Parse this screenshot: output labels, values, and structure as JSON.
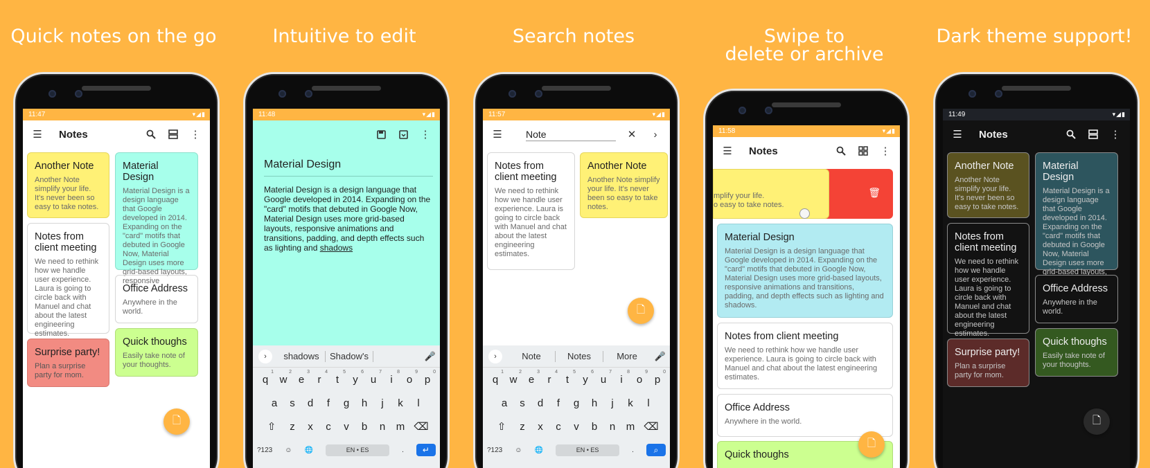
{
  "captions": [
    "Quick notes on the go",
    "Intuitive to edit",
    "Search notes",
    "Swipe to",
    "delete or archive",
    "Dark theme support!"
  ],
  "phones": {
    "p1": {
      "time": "11:47",
      "app_title": "Notes",
      "notes": [
        {
          "title": "Another Note",
          "body": "Another Note simplify your life. It's never been so easy to take notes."
        },
        {
          "title": "Notes from client meeting",
          "body": "We need to rethink how we handle user experience. Laura is going to circle back with Manuel and chat about the latest engineering estimates."
        },
        {
          "title": "Surprise party!",
          "body": "Plan a surprise party for mom."
        },
        {
          "title": "Material Design",
          "body": "Material Design is a design language that Google developed in 2014. Expanding on the \"card\" motifs that debuted in Google Now, Material Design uses more grid-based layouts, responsive"
        },
        {
          "title": "Office Address",
          "body": "Anywhere in the world."
        },
        {
          "title": "Quick thoughs",
          "body": "Easily take note of your thoughts."
        }
      ]
    },
    "p2": {
      "time": "11:48",
      "note_title": "Material Design",
      "note_body": "Material Design is a design language that Google developed in 2014. Expanding on the \"card\" motifs that debuted in Google Now, Material Design uses more grid-based layouts, responsive animations and transitions, padding, and depth effects such as lighting and ",
      "note_body_last": "shadows",
      "suggestions": [
        "shadows",
        "Shadow's"
      ]
    },
    "p3": {
      "time": "11:57",
      "search_value": "Note",
      "notes": [
        {
          "title": "Notes from client meeting",
          "body": "We need to rethink how we handle user experience. Laura is going to circle back with Manuel and chat about the latest engineering estimates."
        },
        {
          "title": "Another Note",
          "body": "Another Note simplify your life. It's never been so easy to take notes."
        }
      ],
      "suggestions": [
        "Note",
        "Notes",
        "More"
      ]
    },
    "p4": {
      "time": "11:58",
      "app_title": "Notes",
      "swiped_text_1": "mplify your life.",
      "swiped_text_2": "o easy to take notes.",
      "notes": [
        {
          "title": "Material Design",
          "body": "Material Design is a design language that Google developed in 2014. Expanding on the \"card\" motifs that debuted in Google Now, Material Design uses more grid-based layouts, responsive animations and transitions, padding, and depth effects such as lighting and shadows."
        },
        {
          "title": "Notes from client meeting",
          "body": "We need to rethink how we handle user experience. Laura is going to circle back with Manuel and chat about the latest engineering estimates."
        },
        {
          "title": "Office Address",
          "body": "Anywhere in the world."
        },
        {
          "title": "Quick thoughs",
          "body": ""
        }
      ]
    },
    "p5": {
      "time": "11:49",
      "app_title": "Notes",
      "notes": [
        {
          "title": "Another Note",
          "body": "Another Note simplify your life. It's never been so easy to take notes."
        },
        {
          "title": "Notes from client meeting",
          "body": "We need to rethink how we handle user experience. Laura is going to circle back with Manuel and chat about the latest engineering estimates."
        },
        {
          "title": "Surprise party!",
          "body": "Plan a surprise party for mom."
        },
        {
          "title": "Material Design",
          "body": "Material Design is a design language that Google developed in 2014. Expanding on the \"card\" motifs that debuted in Google Now, Material Design uses more grid-based layouts, responsive"
        },
        {
          "title": "Office Address",
          "body": "Anywhere in the world."
        },
        {
          "title": "Quick thoughs",
          "body": "Easily take note of your thoughts."
        }
      ]
    }
  },
  "keyboard": {
    "row1": [
      "q",
      "w",
      "e",
      "r",
      "t",
      "y",
      "u",
      "i",
      "o",
      "p"
    ],
    "row1_sup": [
      "1",
      "2",
      "3",
      "4",
      "5",
      "6",
      "7",
      "8",
      "9",
      "0"
    ],
    "row2": [
      "a",
      "s",
      "d",
      "f",
      "g",
      "h",
      "j",
      "k",
      "l"
    ],
    "row3": [
      "z",
      "x",
      "c",
      "v",
      "b",
      "n",
      "m"
    ],
    "sym": "?123",
    "space": "EN • ES",
    "period": "."
  },
  "colors": {
    "background": "#FFB543",
    "yellow": "#FFF176",
    "teal": "#A7FFEB",
    "cyan": "#B2EBF2",
    "red": "#F28B82",
    "green": "#CCFF90",
    "delete": "#F44336",
    "dark_bg": "#121212"
  },
  "icons": [
    "menu-icon",
    "search-icon",
    "view-agenda-icon",
    "grid-view-icon",
    "more-vert-icon",
    "save-icon",
    "archive-icon",
    "close-icon",
    "chevron-right-icon",
    "mic-icon",
    "delete-icon",
    "add-note-icon"
  ]
}
